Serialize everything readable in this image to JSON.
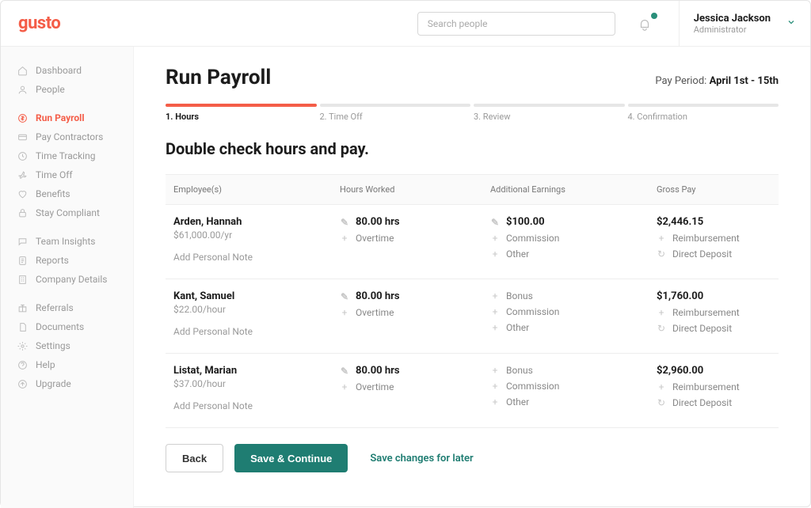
{
  "brand": "gusto",
  "search": {
    "placeholder": "Search people"
  },
  "user": {
    "name": "Jessica Jackson",
    "role": "Administrator"
  },
  "sidebar": {
    "items": [
      {
        "label": "Dashboard"
      },
      {
        "label": "People"
      },
      {
        "label": "Run Payroll"
      },
      {
        "label": "Pay Contractors"
      },
      {
        "label": "Time Tracking"
      },
      {
        "label": "Time Off"
      },
      {
        "label": "Benefits"
      },
      {
        "label": "Stay Compliant"
      },
      {
        "label": "Team Insights"
      },
      {
        "label": "Reports"
      },
      {
        "label": "Company Details"
      },
      {
        "label": "Referrals"
      },
      {
        "label": "Documents"
      },
      {
        "label": "Settings"
      },
      {
        "label": "Help"
      },
      {
        "label": "Upgrade"
      }
    ]
  },
  "page": {
    "title": "Run Payroll",
    "pay_period_label": "Pay Period: ",
    "pay_period_value": "April 1st - 15th",
    "subtitle": "Double check hours and pay."
  },
  "stepper": [
    {
      "label": "1. Hours"
    },
    {
      "label": "2. Time Off"
    },
    {
      "label": "3. Review"
    },
    {
      "label": "4. Confirmation"
    }
  ],
  "table": {
    "headers": {
      "employee": "Employee(s)",
      "hours": "Hours Worked",
      "earnings": "Additional Earnings",
      "gross": "Gross Pay"
    },
    "labels": {
      "add_note": "Add Personal Note",
      "overtime": "Overtime",
      "bonus": "Bonus",
      "commission": "Commission",
      "other": "Other",
      "reimbursement": "Reimbursement",
      "direct_deposit": "Direct Deposit"
    },
    "rows": [
      {
        "name": "Arden, Hannah",
        "rate": "$61,000.00/yr",
        "hours": "80.00 hrs",
        "bonus": "$100.00",
        "gross": "$2,446.15"
      },
      {
        "name": "Kant, Samuel",
        "rate": "$22.00/hour",
        "hours": "80.00 hrs",
        "bonus": "",
        "gross": "$1,760.00"
      },
      {
        "name": "Listat, Marian",
        "rate": "$37.00/hour",
        "hours": "80.00 hrs",
        "bonus": "",
        "gross": "$2,960.00"
      }
    ]
  },
  "actions": {
    "back": "Back",
    "save_continue": "Save & Continue",
    "save_later": "Save changes for later"
  }
}
